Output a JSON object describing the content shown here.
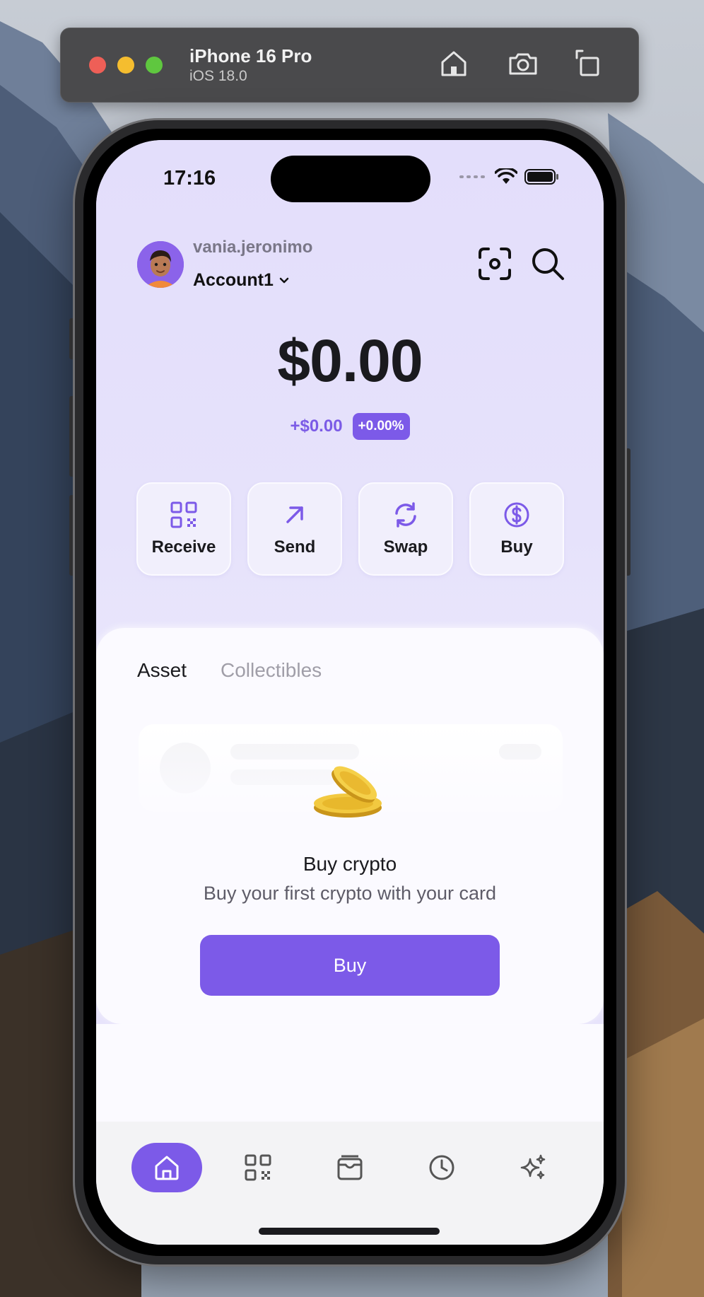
{
  "simulator": {
    "device_name": "iPhone 16 Pro",
    "os_version": "iOS 18.0",
    "buttons": [
      "home-icon",
      "screenshot-icon",
      "rotate-icon"
    ]
  },
  "status_bar": {
    "time": "17:16"
  },
  "header": {
    "username": "vania.jeronimo",
    "account_name": "Account1",
    "icons": [
      "scan-icon",
      "search-icon"
    ]
  },
  "balance": {
    "amount": "$0.00",
    "change_amount": "+$0.00",
    "change_percent": "+0.00%"
  },
  "actions": [
    {
      "label": "Receive",
      "icon": "qr-code-icon"
    },
    {
      "label": "Send",
      "icon": "arrow-up-right-icon"
    },
    {
      "label": "Swap",
      "icon": "swap-icon"
    },
    {
      "label": "Buy",
      "icon": "dollar-circle-icon"
    }
  ],
  "tabs": [
    {
      "label": "Asset",
      "active": true
    },
    {
      "label": "Collectibles",
      "active": false
    }
  ],
  "empty_state": {
    "title": "Buy crypto",
    "subtitle": "Buy your first crypto with your card",
    "button_label": "Buy",
    "icon": "coin-icon"
  },
  "bottom_nav": [
    {
      "icon": "home-icon",
      "active": true
    },
    {
      "icon": "qr-code-icon",
      "active": false
    },
    {
      "icon": "wallet-icon",
      "active": false
    },
    {
      "icon": "history-icon",
      "active": false
    },
    {
      "icon": "sparkles-icon",
      "active": false
    }
  ],
  "colors": {
    "accent": "#7c5ae8",
    "screen_bg": "#e6e2fb",
    "card_bg": "#fbfaff"
  }
}
